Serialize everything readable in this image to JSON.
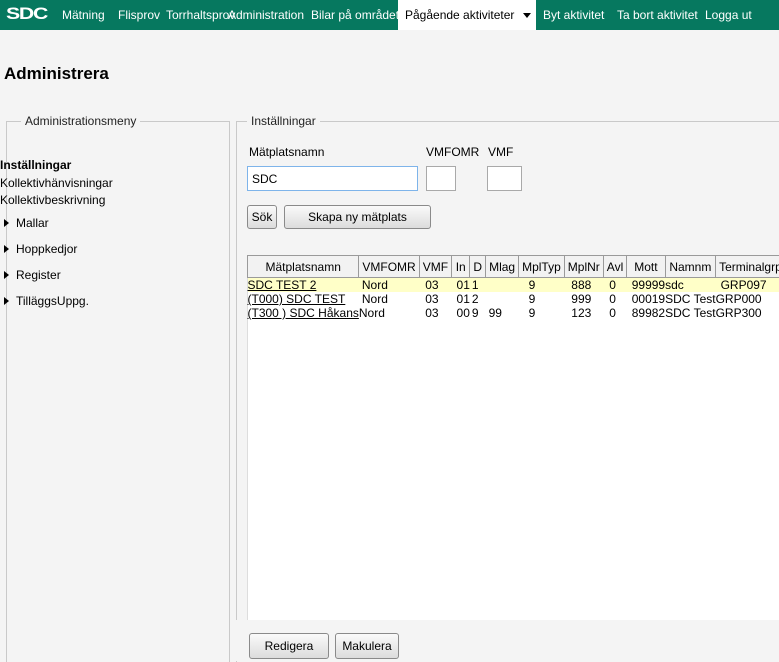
{
  "nav": {
    "logo": "SDC",
    "items": [
      "Mätning",
      "Flisprov",
      "Torrhaltsprov",
      "Administration",
      "Bilar på området"
    ],
    "active": "Pågående aktiviteter",
    "right_items": [
      "Byt aktivitet",
      "Ta bort aktivitet",
      "Logga ut"
    ]
  },
  "page_title": "Administrera",
  "left_menu": {
    "legend": "Administrationsmeny",
    "heading": "Inställningar",
    "links": [
      "Kollektivhänvisningar",
      "Kollektivbeskrivning"
    ],
    "expandable": [
      "Mallar",
      "Hoppkedjor",
      "Register",
      "TilläggsUppg."
    ]
  },
  "settings": {
    "legend": "Inställningar",
    "matplatsnamn_label": "Mätplatsnamn",
    "vmfomr_label": "VMFOMR",
    "vmf_label": "VMF",
    "matplatsnamn_value": "SDC",
    "vmfomr_value": "",
    "vmf_value": "",
    "search_button": "Sök",
    "new_button": "Skapa ny mätplats"
  },
  "table": {
    "columns": [
      "Mätplatsnamn",
      "VMFOMR",
      "VMF",
      "In",
      "D",
      "Mlag",
      "MplTyp",
      "MplNr",
      "Avl",
      "Mott",
      "Namnm",
      "Terminalgrp"
    ],
    "rows": [
      [
        "SDC TEST 2",
        "Nord",
        "03",
        "01",
        "1",
        "",
        "9",
        "888",
        "0",
        "99999",
        "sdc",
        "GRP097"
      ],
      [
        "(T000) SDC TEST",
        "Nord",
        "03",
        "01",
        "2",
        "",
        "9",
        "999",
        "0",
        "00019",
        "SDC Test",
        "GRP000"
      ],
      [
        "(T300 ) SDC Håkans",
        "Nord",
        "03",
        "00",
        "9",
        "99",
        "9",
        "123",
        "0",
        "89982",
        "SDC Test",
        "GRP300"
      ]
    ]
  },
  "bottom": {
    "edit_button": "Redigera",
    "cancel_button": "Makulera"
  }
}
